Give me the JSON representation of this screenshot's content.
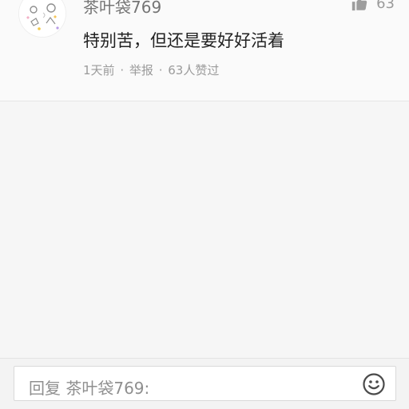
{
  "comment": {
    "username": "茶叶袋769",
    "text": "特别苦，但还是要好好活着",
    "time": "1天前",
    "dot1": "·",
    "report": "举报",
    "dot2": "·",
    "likes_text": "63人赞过",
    "like_count": "63",
    "avatar_icon": "doodle-avatar-icon",
    "like_icon": "thumbs-up-icon"
  },
  "reply": {
    "placeholder": "回复 茶叶袋769:",
    "emoji_icon": "smiley-icon"
  }
}
